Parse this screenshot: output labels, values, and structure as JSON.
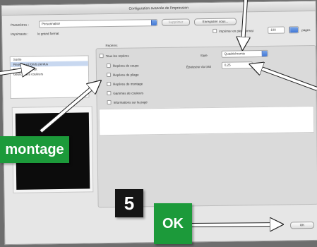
{
  "dialog": {
    "title": "Configuration avancée de l'impression",
    "preset_label": "Paramètres :",
    "preset_value": "Personnalisé",
    "delete_button": "Supprimer",
    "save_preset_button": "Enregistrer sous...",
    "printer_label": "Imprimante :",
    "printer_value": "le grand format",
    "fullscreen_checkbox": "Imprimer en plein format",
    "zoom_value": "100",
    "page_count": "pages",
    "ok_button": "OK"
  },
  "sidebar": {
    "items": [
      {
        "label": "Sortie",
        "selected": false
      },
      {
        "label": "Repères et fonds perdus",
        "selected": true
      },
      {
        "label": "Sortie PostScript",
        "selected": false
      },
      {
        "label": "Gestion des couleurs",
        "selected": false
      }
    ]
  },
  "marks": {
    "group_title": "Repères",
    "all_marks": "Tous les repères",
    "items": [
      "Repères de coupe",
      "Repères de pliage",
      "Repères de montage",
      "Gammes de couleurs",
      "Informations sur la page"
    ],
    "type_label": "Style",
    "type_value": "Quadrichromie",
    "weight_label": "Épaisseur du trait",
    "weight_value": "0,25"
  },
  "callouts": {
    "montage": "montage",
    "step_number": "5",
    "ok": "OK"
  },
  "colors": {
    "callout_green": "#1c9a3a",
    "arrow_white": "#ffffff",
    "dark_badge": "#151515"
  }
}
